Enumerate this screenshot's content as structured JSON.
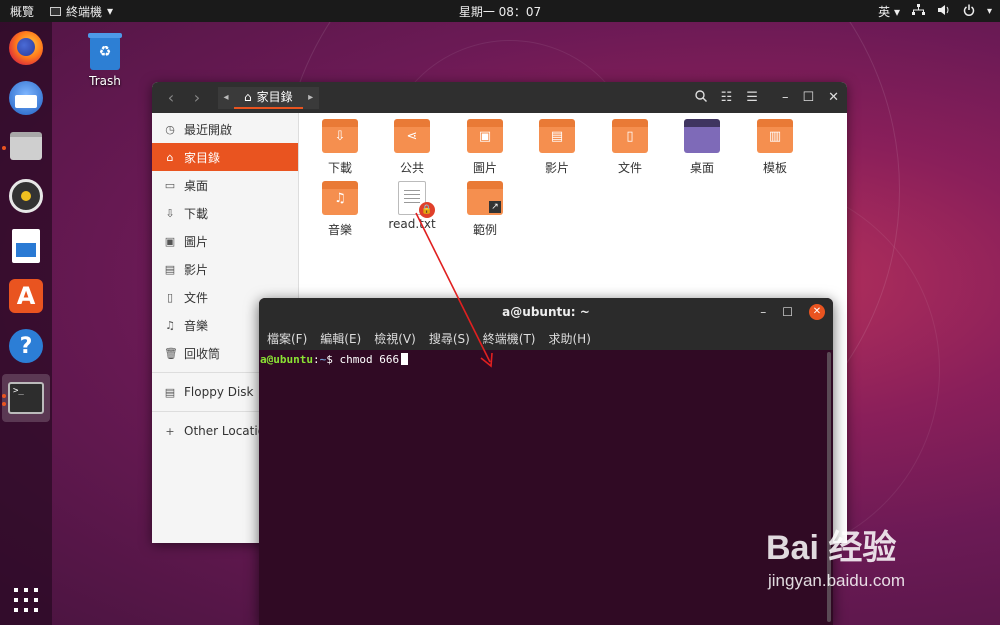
{
  "topbar": {
    "overview": "概覽",
    "app_name": "終端機",
    "app_arrow": "▾",
    "clock": "星期一 08：07",
    "lang": "英",
    "lang_arrow": "▾",
    "icons": [
      "network-icon",
      "volume-icon",
      "power-icon"
    ]
  },
  "desktop": {
    "trash_label": "Trash"
  },
  "files_window": {
    "path_label": "家目錄",
    "sidebar": [
      {
        "label": "最近開啟",
        "icon": "clock-icon",
        "glyph": "◷"
      },
      {
        "label": "家目錄",
        "icon": "home-icon",
        "glyph": "⌂",
        "active": true
      },
      {
        "label": "桌面",
        "icon": "desktop-icon",
        "glyph": "▭"
      },
      {
        "label": "下載",
        "icon": "download-icon",
        "glyph": "⇩"
      },
      {
        "label": "圖片",
        "icon": "pictures-icon",
        "glyph": "▣"
      },
      {
        "label": "影片",
        "icon": "videos-icon",
        "glyph": "▤"
      },
      {
        "label": "文件",
        "icon": "documents-icon",
        "glyph": "▯"
      },
      {
        "label": "音樂",
        "icon": "music-icon",
        "glyph": "♫"
      },
      {
        "label": "回收筒",
        "icon": "trash-icon",
        "glyph": "🗑"
      }
    ],
    "sidebar_devices": [
      {
        "label": "Floppy Disk",
        "icon": "disk-icon",
        "glyph": "▤"
      },
      {
        "label": "Other Locations",
        "icon": "plus-icon",
        "glyph": "+"
      }
    ],
    "items": [
      {
        "label": "下載",
        "glyph": "⇩"
      },
      {
        "label": "公共",
        "glyph": "⋖"
      },
      {
        "label": "圖片",
        "glyph": "▣"
      },
      {
        "label": "影片",
        "glyph": "▤"
      },
      {
        "label": "文件",
        "glyph": "▯"
      },
      {
        "label": "桌面",
        "glyph": ""
      },
      {
        "label": "模板",
        "glyph": "▥"
      },
      {
        "label": "音樂",
        "glyph": "♫"
      },
      {
        "label": "read.txt",
        "glyph": ""
      },
      {
        "label": "範例",
        "glyph": ""
      }
    ]
  },
  "terminal": {
    "title": "a@ubuntu: ~",
    "menu": [
      "檔案(F)",
      "編輯(E)",
      "檢視(V)",
      "搜尋(S)",
      "終端機(T)",
      "求助(H)"
    ],
    "prompt_user": "a@ubuntu",
    "prompt_sep": ":",
    "prompt_path": "~",
    "prompt_sign": "$",
    "command": "chmod 666"
  },
  "watermark": {
    "logo": "Bai 经验",
    "url": "jingyan.baidu.com"
  },
  "colors": {
    "accent": "#e95420",
    "terminal_bg": "#300a24",
    "prompt_user": "#8ae234",
    "prompt_path": "#729fcf",
    "folder": "#f58f4f",
    "arrow": "#e02020"
  }
}
